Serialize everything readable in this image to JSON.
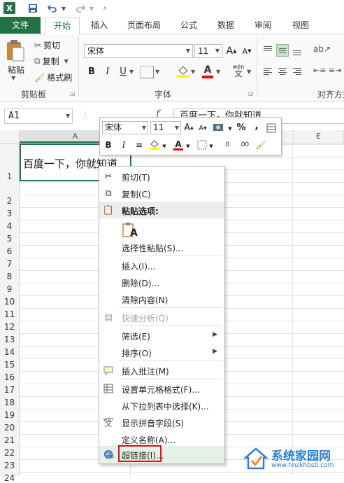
{
  "qat": {
    "logo": "X"
  },
  "tabs": [
    "文件",
    "开始",
    "插入",
    "页面布局",
    "公式",
    "数据",
    "审阅",
    "视图"
  ],
  "ribbon": {
    "paste": "粘贴",
    "cut": "剪切",
    "copy": "复制",
    "format_painter": "格式刷",
    "clipboard_group": "剪贴板",
    "font_name": "宋体",
    "font_size": "11",
    "font_group": "字体",
    "align_group": "对齐方式",
    "bold": "B",
    "italic": "I",
    "underline": "U",
    "font_color_letter": "A",
    "wen_top": "wén",
    "wen_bottom": "文"
  },
  "formula_bar": {
    "name_box": "A1",
    "fx": "f",
    "content": "百度一下，你就知道"
  },
  "grid": {
    "columns": [
      "A",
      "E"
    ],
    "rows": [
      "1",
      "2",
      "3",
      "4",
      "5",
      "6",
      "7",
      "8",
      "9",
      "10",
      "11",
      "12",
      "13",
      "14",
      "15",
      "16",
      "17",
      "18",
      "19",
      "20",
      "21",
      "22",
      "23",
      "24"
    ],
    "a1_value": "百度一下，你就知道"
  },
  "mini_toolbar": {
    "font_name": "宋体",
    "font_size": "11",
    "percent": "%",
    "comma": ",",
    "bold": "B",
    "italic": "I",
    "font_color_letter": "A",
    "dec_inc": ".0",
    "dec_dec": ".00"
  },
  "context_menu": {
    "items": [
      {
        "label": "剪切(T)",
        "icon": "scissors-icon"
      },
      {
        "label": "复制(C)",
        "icon": "copy-icon"
      },
      {
        "label": "粘贴选项:",
        "icon": "paste-icon"
      },
      {
        "label": "A",
        "icon": "paste-values-icon"
      },
      {
        "label": "选择性粘贴(S)...",
        "icon": ""
      },
      {
        "label": "插入(I)...",
        "icon": ""
      },
      {
        "label": "删除(D)...",
        "icon": ""
      },
      {
        "label": "清除内容(N)",
        "icon": ""
      },
      {
        "label": "快速分析(Q)",
        "icon": "quick-analysis-icon",
        "disabled": true
      },
      {
        "label": "筛选(E)",
        "icon": "",
        "submenu": true
      },
      {
        "label": "排序(O)",
        "icon": "",
        "submenu": true
      },
      {
        "label": "插入批注(M)",
        "icon": "comment-icon"
      },
      {
        "label": "设置单元格格式(F)...",
        "icon": "format-cells-icon"
      },
      {
        "label": "从下拉列表中选择(K)...",
        "icon": ""
      },
      {
        "label": "显示拼音字段(S)",
        "icon": "phonetic-icon"
      },
      {
        "label": "定义名称(A)...",
        "icon": ""
      },
      {
        "label": "超链接(I)...",
        "icon": "hyperlink-icon"
      }
    ]
  },
  "watermark": {
    "title": "系统家园网",
    "url": "www.hnzkhbsb.com"
  },
  "colors": {
    "excel_green": "#217346",
    "highlight_red": "#dd1111",
    "hover_green": "#e5f1e5"
  }
}
